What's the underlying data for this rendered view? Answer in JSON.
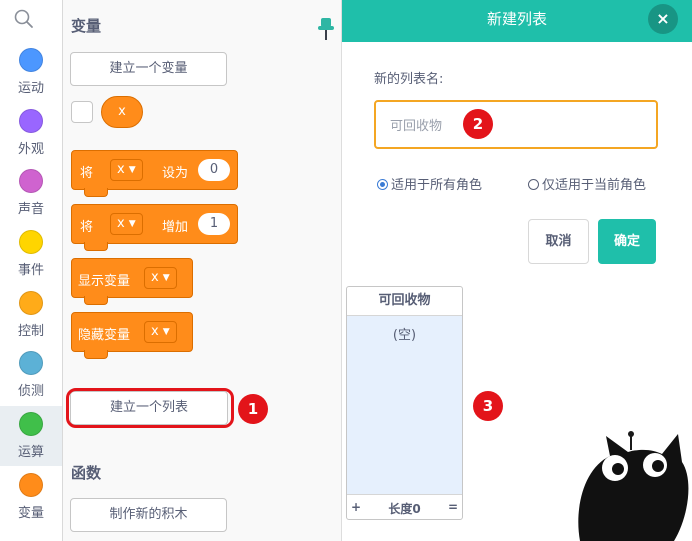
{
  "categories": [
    {
      "label": "运动",
      "color": "#4c97ff"
    },
    {
      "label": "外观",
      "color": "#9966ff"
    },
    {
      "label": "声音",
      "color": "#cf63cf"
    },
    {
      "label": "事件",
      "color": "#ffd500"
    },
    {
      "label": "控制",
      "color": "#ffab19"
    },
    {
      "label": "侦测",
      "color": "#5cb1d6"
    },
    {
      "label": "运算",
      "color": "#40bf4a"
    },
    {
      "label": "变量",
      "color": "#ff8c1a"
    }
  ],
  "palette": {
    "variables_title": "变量",
    "make_variable": "建立一个变量",
    "var_reporter": "x",
    "set_block": {
      "prefix": "将",
      "var": "x",
      "mid": "设为",
      "value": "0"
    },
    "change_block": {
      "prefix": "将",
      "var": "x",
      "mid": "增加",
      "value": "1"
    },
    "show_block": {
      "label": "显示变量",
      "var": "x"
    },
    "hide_block": {
      "label": "隐藏变量",
      "var": "x"
    },
    "make_list": "建立一个列表",
    "functions_title": "函数",
    "make_block": "制作新的积木"
  },
  "badges": [
    "1",
    "2",
    "3"
  ],
  "dialog": {
    "title": "新建列表",
    "close": "×",
    "name_label": "新的列表名:",
    "input_value": "可回收物",
    "radio_all": "适用于所有角色",
    "radio_current": "仅适用于当前角色",
    "cancel": "取消",
    "ok": "确定"
  },
  "list_monitor": {
    "title": "可回收物",
    "empty": "(空)",
    "plus": "+",
    "length": "长度0",
    "resize": "="
  }
}
